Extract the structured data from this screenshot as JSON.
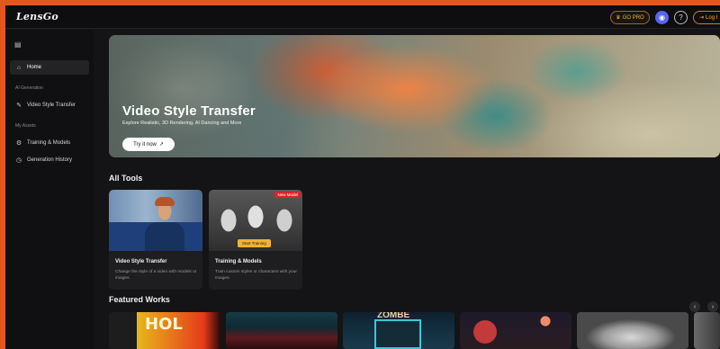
{
  "app": {
    "logo": "LensGo"
  },
  "header": {
    "gopro_label": "GO PRO",
    "gopro_icon": "crown-icon",
    "discord_icon": "discord-icon",
    "help_icon": "help-icon",
    "login_label": "Log I",
    "login_icon": "login-icon"
  },
  "sidebar": {
    "collapse_icon": "sidebar-toggle-icon",
    "home": "Home",
    "section_ai": "AI Generation",
    "video_style": "Video Style Transfer",
    "section_assets": "My Assets",
    "training": "Training & Models",
    "history": "Generation History"
  },
  "hero": {
    "title": "Video Style Transfer",
    "subtitle": "Explore Realistic, 3D Rendering, AI Dancing and More",
    "button": "Try it now",
    "button_icon": "arrow-up-right-icon"
  },
  "tools": {
    "title": "All Tools",
    "items": [
      {
        "name": "Video Style Transfer",
        "desc": "Change the style of a video with models or images."
      },
      {
        "name": "Training & Models",
        "desc": "Train custom styles or characters with your images.",
        "badge": "New Model",
        "cta": "Start Training"
      }
    ]
  },
  "featured": {
    "title": "Featured Works",
    "works": [
      {
        "text": "HOL"
      },
      {
        "text": ""
      },
      {
        "text": "ZOMBE"
      },
      {
        "text": ""
      },
      {
        "text": ""
      },
      {
        "text": ""
      }
    ]
  },
  "colors": {
    "accent": "#e3571f",
    "gold": "#f0b030",
    "discord": "#5865f2",
    "new_badge": "#d3262c"
  }
}
